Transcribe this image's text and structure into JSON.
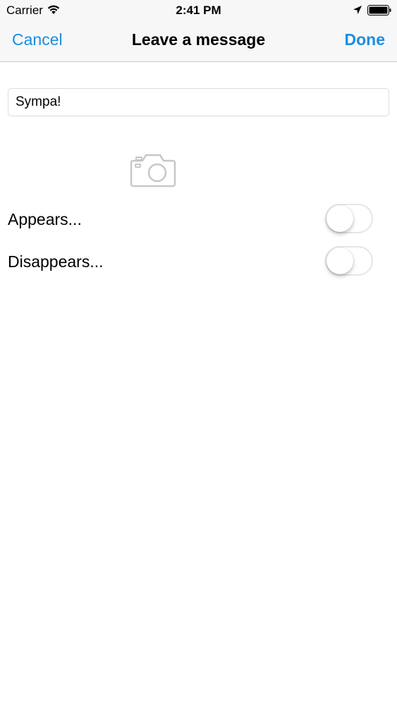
{
  "status_bar": {
    "carrier": "Carrier",
    "time": "2:41 PM",
    "icons": [
      "wifi-icon",
      "location-icon",
      "battery-icon"
    ]
  },
  "nav": {
    "cancel_label": "Cancel",
    "title": "Leave a message",
    "done_label": "Done"
  },
  "message": {
    "value": "Sympa!"
  },
  "camera": {
    "icon": "camera-icon"
  },
  "options": [
    {
      "label": "Appears...",
      "on": false
    },
    {
      "label": "Disappears...",
      "on": false
    }
  ],
  "colors": {
    "accent": "#1a8ee0",
    "nav_background": "#f7f7f7",
    "divider": "#c8c7cc",
    "camera_icon": "#c7c7c7"
  }
}
